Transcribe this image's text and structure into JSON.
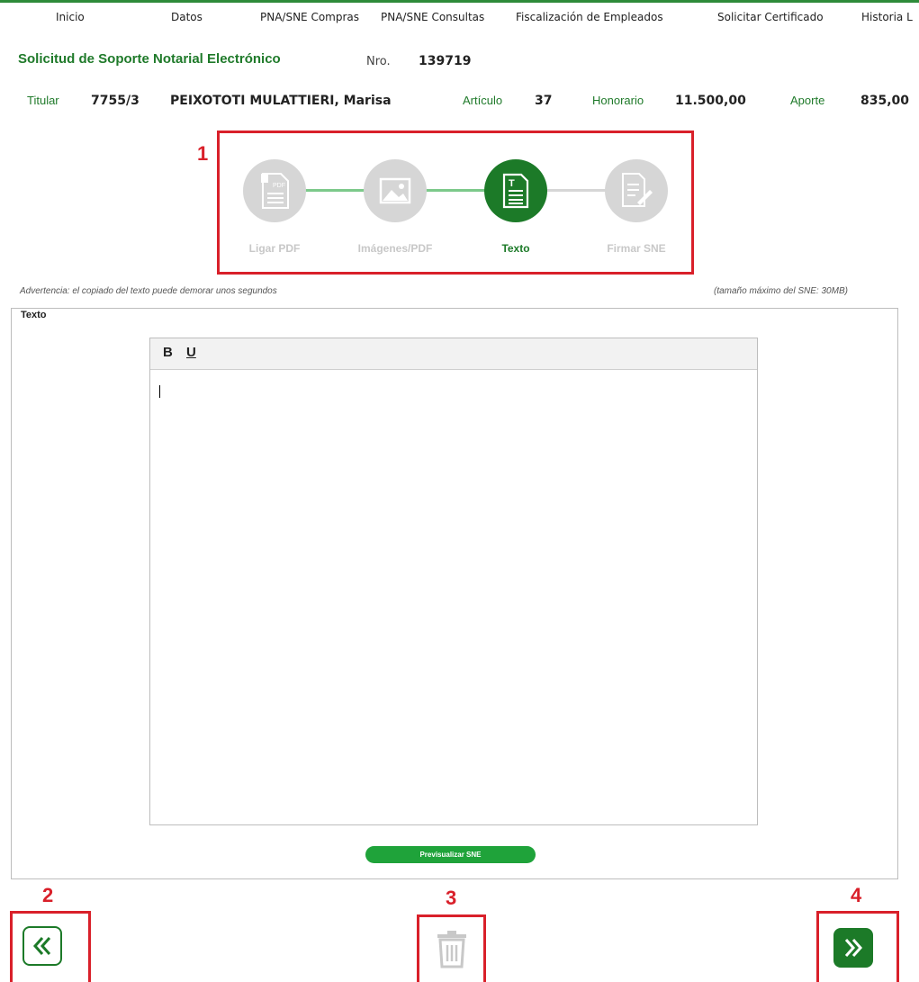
{
  "nav": {
    "items": [
      "Inicio",
      "Datos",
      "PNA/SNE Compras",
      "PNA/SNE Consultas",
      "Fiscalización de Empleados",
      "Solicitar Certificado",
      "Historia L"
    ]
  },
  "header": {
    "title": "Solicitud de Soporte Notarial Electrónico",
    "nro_label": "Nro.",
    "nro_value": "139719"
  },
  "info": {
    "titular_label": "Titular",
    "titular_code": "7755/3",
    "titular_name": "PEIXOTOTI MULATTIERI, Marisa",
    "articulo_label": "Artículo",
    "articulo_value": "37",
    "honorario_label": "Honorario",
    "honorario_value": "11.500,00",
    "aporte_label": "Aporte",
    "aporte_value": "835,00"
  },
  "annotations": [
    "1",
    "2",
    "3",
    "4"
  ],
  "steps": [
    {
      "label": "Ligar PDF",
      "icon": "pdf-icon",
      "state": "inactive"
    },
    {
      "label": "Imágenes/PDF",
      "icon": "image-icon",
      "state": "inactive"
    },
    {
      "label": "Texto",
      "icon": "text-document-icon",
      "state": "active"
    },
    {
      "label": "Firmar SNE",
      "icon": "sign-document-icon",
      "state": "inactive"
    }
  ],
  "notes": {
    "warning": "Advertencia: el copiado del texto puede demorar unos segundos",
    "max_size": "(tamaño máximo del SNE: 30MB)"
  },
  "editor": {
    "legend": "Texto",
    "bold": "B",
    "underline": "U",
    "content": ""
  },
  "buttons": {
    "preview": "Previsualizar SNE"
  },
  "colors": {
    "brand_green": "#1c7a28",
    "annotation_red": "#d9202a",
    "inactive_gray": "#d6d6d6"
  }
}
